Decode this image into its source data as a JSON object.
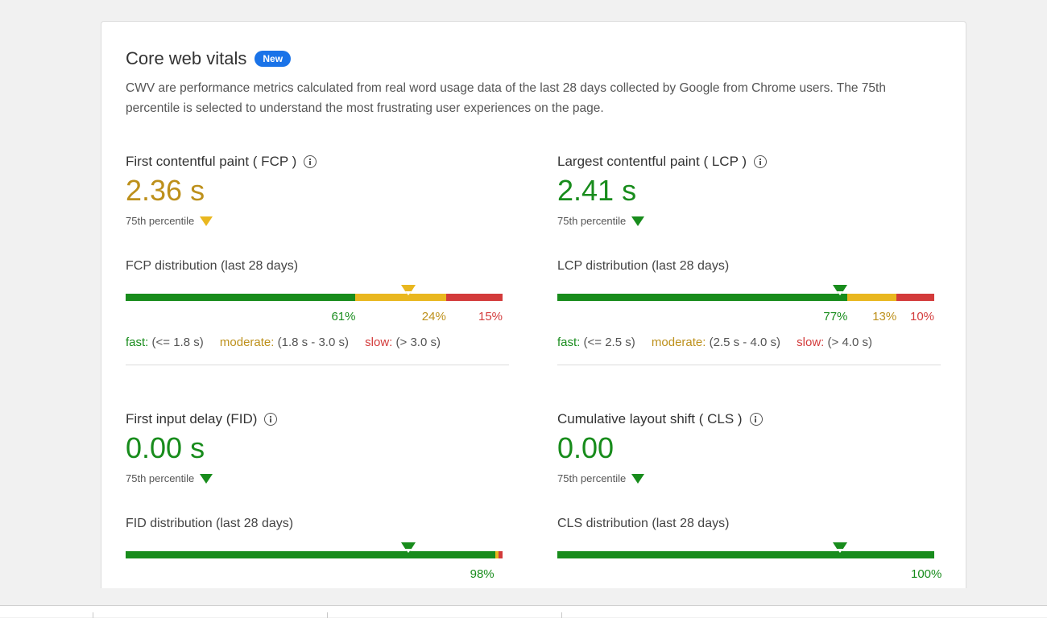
{
  "card": {
    "title": "Core web vitals",
    "badge": "New",
    "description": "CWV are performance metrics calculated from real word usage data of the last 28 days collected by Google from Chrome users. The 75th percentile is selected to understand the most frustrating user experiences on the page."
  },
  "colors": {
    "good": "#188c1c",
    "moderate": "#e9b71f",
    "slow": "#d33b3b",
    "amber_text": "#bd901b",
    "badge": "#1a73e8"
  },
  "metrics": {
    "fcp": {
      "title": "First contentful paint ( FCP )",
      "value": "2.36 s",
      "percentile_label": "75th percentile",
      "status": "moderate",
      "distribution_title": "FCP distribution (last 28 days)",
      "fast_pct": "61%",
      "moderate_pct": "24%",
      "slow_pct": "15%",
      "fast_fraction": 0.61,
      "moderate_fraction": 0.24,
      "slow_fraction": 0.15,
      "marker_fraction": 0.75,
      "legend": {
        "fast_label": "fast:",
        "fast_range": "(<= 1.8 s)",
        "moderate_label": "moderate:",
        "moderate_range": "(1.8 s - 3.0 s)",
        "slow_label": "slow:",
        "slow_range": "(> 3.0 s)"
      }
    },
    "lcp": {
      "title": "Largest contentful paint ( LCP )",
      "value": "2.41 s",
      "percentile_label": "75th percentile",
      "status": "good",
      "distribution_title": "LCP distribution (last 28 days)",
      "fast_pct": "77%",
      "moderate_pct": "13%",
      "slow_pct": "10%",
      "fast_fraction": 0.77,
      "moderate_fraction": 0.13,
      "slow_fraction": 0.1,
      "marker_fraction": 0.75,
      "legend": {
        "fast_label": "fast:",
        "fast_range": "(<= 2.5 s)",
        "moderate_label": "moderate:",
        "moderate_range": "(2.5 s - 4.0 s)",
        "slow_label": "slow:",
        "slow_range": "(> 4.0 s)"
      }
    },
    "fid": {
      "title": "First input delay (FID)",
      "value": "0.00 s",
      "percentile_label": "75th percentile",
      "status": "good",
      "distribution_title": "FID distribution (last 28 days)",
      "fast_pct": "98%",
      "fast_fraction": 0.98,
      "moderate_fraction": 0.01,
      "slow_fraction": 0.01,
      "marker_fraction": 0.75
    },
    "cls": {
      "title": "Cumulative layout shift ( CLS )",
      "value": "0.00",
      "percentile_label": "75th percentile",
      "status": "good",
      "distribution_title": "CLS distribution (last 28 days)",
      "fast_pct": "100%",
      "fast_fraction": 1.0,
      "moderate_fraction": 0,
      "slow_fraction": 0,
      "marker_fraction": 0.75
    }
  }
}
